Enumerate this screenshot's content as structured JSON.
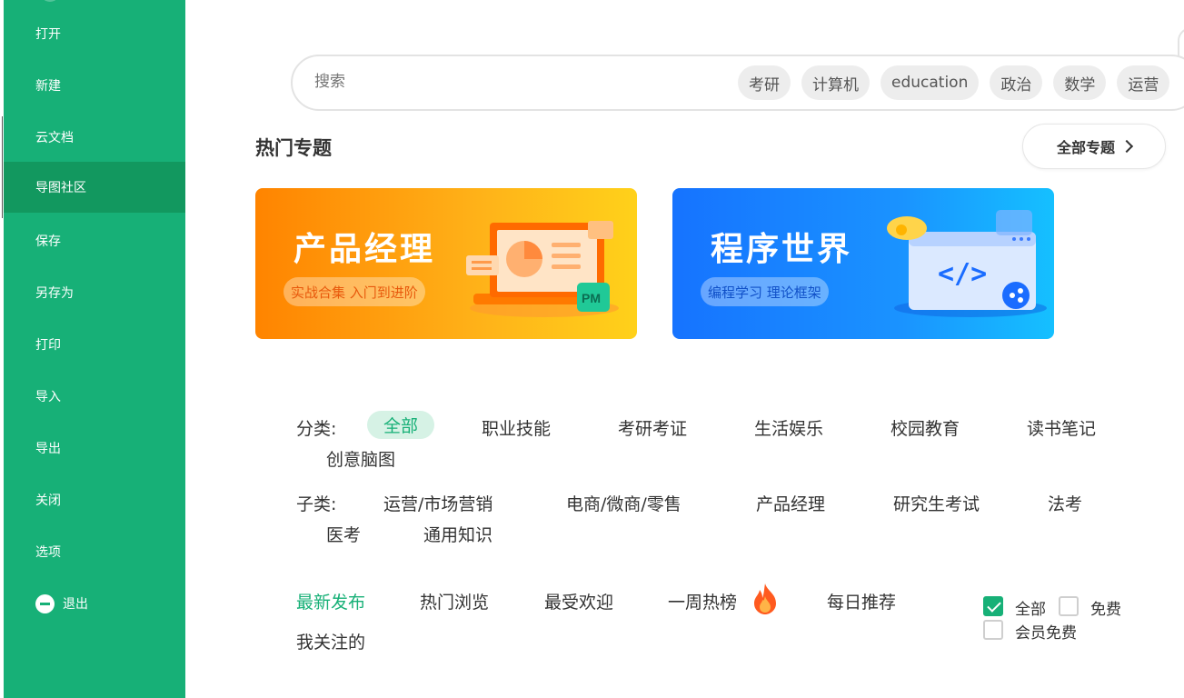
{
  "sidebar": {
    "items": [
      {
        "label": "打开"
      },
      {
        "label": "新建"
      },
      {
        "label": "云文档"
      },
      {
        "label": "导图社区"
      },
      {
        "label": "保存"
      },
      {
        "label": "另存为"
      },
      {
        "label": "打印"
      },
      {
        "label": "导入"
      },
      {
        "label": "导出"
      },
      {
        "label": "关闭"
      },
      {
        "label": "选项"
      },
      {
        "label": "退出"
      }
    ],
    "active": "导图社区"
  },
  "search": {
    "placeholder": "搜索",
    "tags": [
      "考研",
      "计算机",
      "education",
      "政治",
      "数学",
      "运营"
    ]
  },
  "hot": {
    "title": "热门专题",
    "all_label": "全部专题",
    "banners": [
      {
        "title": "产品经理",
        "subtitle": "实战合集 入门到进阶",
        "badge": "PM"
      },
      {
        "title": "程序世界",
        "subtitle": "编程学习 理论框架",
        "code": "</>"
      }
    ]
  },
  "categories": {
    "label": "分类:",
    "items": [
      "全部",
      "职业技能",
      "考研考证",
      "生活娱乐",
      "校园教育",
      "读书笔记",
      "创意脑图"
    ],
    "active": "全部"
  },
  "subcategories": {
    "label": "子类:",
    "items": [
      "运营/市场营销",
      "电商/微商/零售",
      "产品经理",
      "研究生考试",
      "法考",
      "医考",
      "通用知识"
    ]
  },
  "sort_tabs": {
    "items": [
      "最新发布",
      "热门浏览",
      "最受欢迎",
      "一周热榜",
      "每日推荐",
      "我关注的"
    ],
    "active": "最新发布"
  },
  "filters": {
    "items": [
      {
        "label": "全部",
        "checked": true
      },
      {
        "label": "免费",
        "checked": false
      },
      {
        "label": "会员免费",
        "checked": false
      }
    ]
  },
  "colors": {
    "brand": "#17b077",
    "brand_dark": "#12985f"
  }
}
